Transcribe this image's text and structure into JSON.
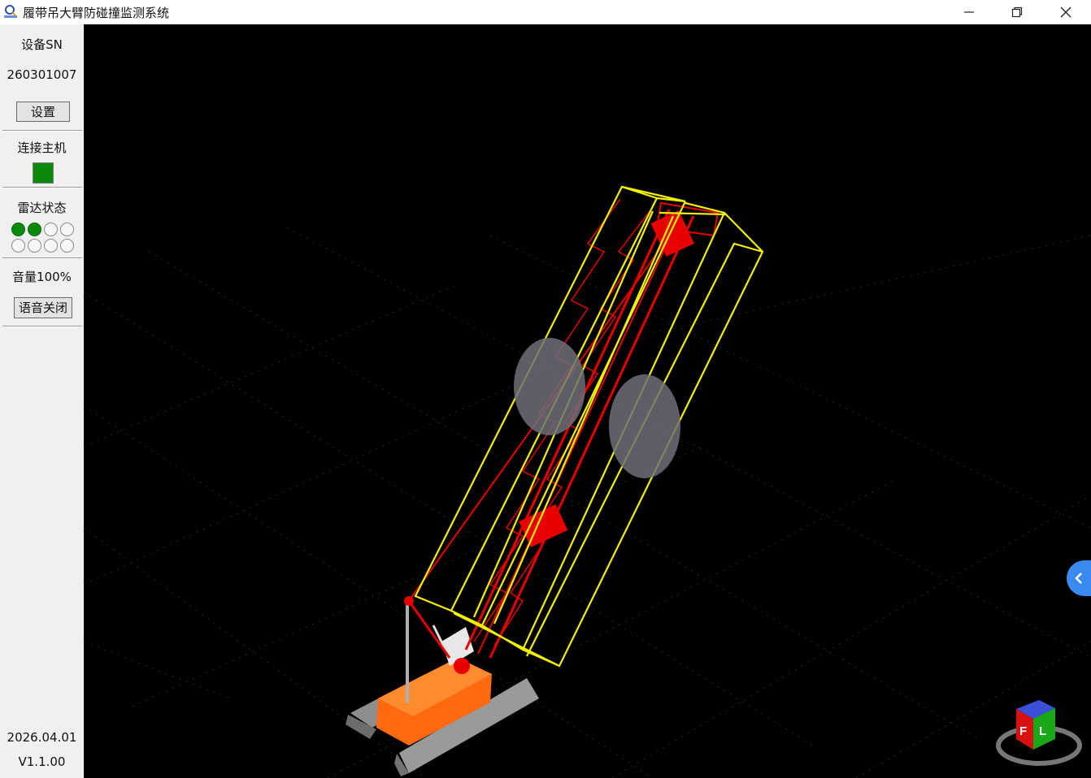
{
  "window": {
    "title": "履带吊大臂防碰撞监测系统"
  },
  "sidebar": {
    "device_sn_label": "设备SN",
    "device_sn_value": "260301007",
    "settings_button": "设置",
    "connect_host_label": "连接主机",
    "radar_status_label": "雷达状态",
    "radar_dots": [
      true,
      true,
      false,
      false,
      false,
      false,
      false,
      false
    ],
    "volume_label": "音量100%",
    "voice_button": "语音关闭",
    "date": "2026.04.01",
    "version": "V1.1.00"
  },
  "colors": {
    "connected": "#0a8a0a",
    "radar_active": "#0a8a0a",
    "boom_red": "#e80000",
    "collision_box": "#f2f200",
    "crane_body": "#ff6a10",
    "toggle_blue": "#3a8af0"
  },
  "view_cube": {
    "front_label": "F",
    "left_label": "L"
  }
}
